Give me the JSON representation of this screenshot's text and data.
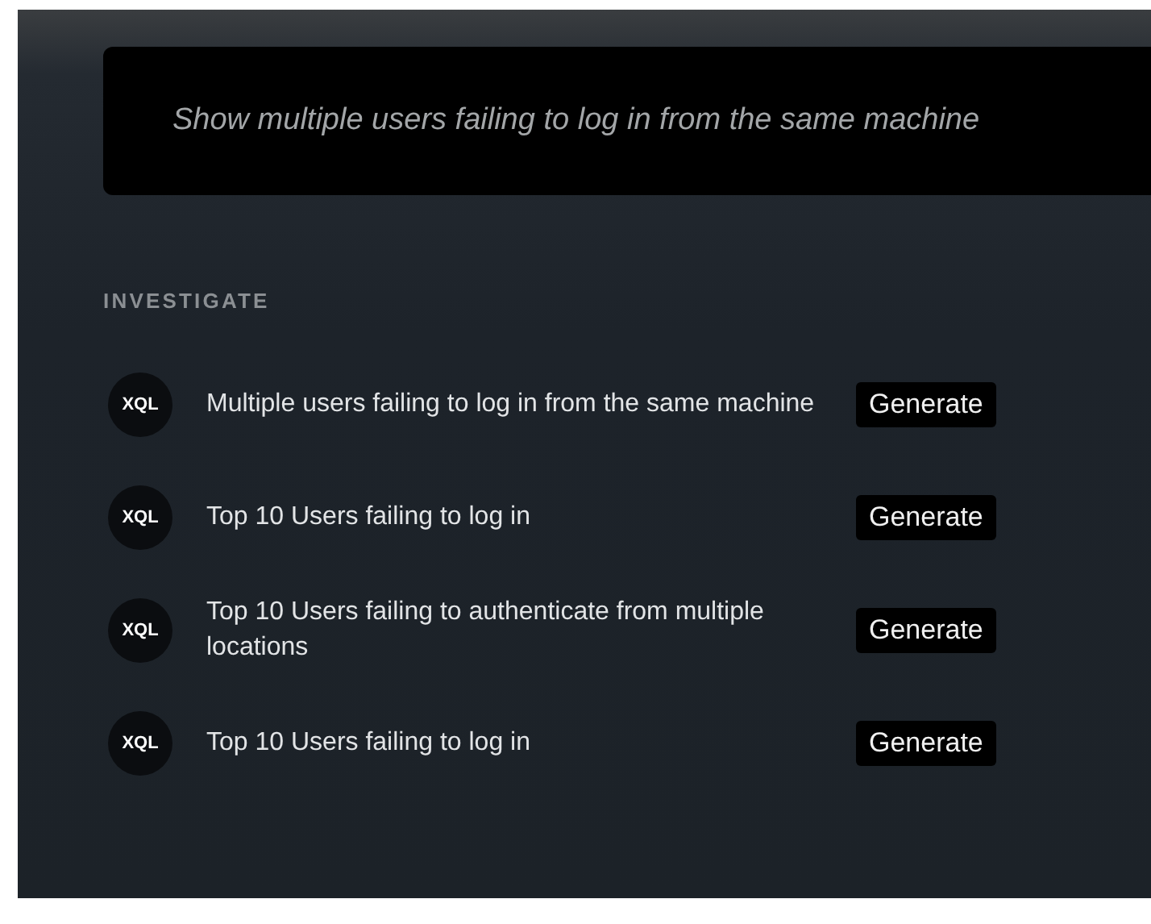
{
  "prompt": {
    "text": "Show multiple users failing to log in from the same machine"
  },
  "section": {
    "title": "INVESTIGATE"
  },
  "items": [
    {
      "badge": "XQL",
      "text": "Multiple users failing to log in from the same machine",
      "button": "Generate"
    },
    {
      "badge": "XQL",
      "text": "Top 10 Users failing to log in",
      "button": "Generate"
    },
    {
      "badge": "XQL",
      "text": "Top 10 Users failing to authenticate from multiple locations",
      "button": "Generate"
    },
    {
      "badge": "XQL",
      "text": "Top 10 Users failing to log in",
      "button": "Generate"
    }
  ]
}
